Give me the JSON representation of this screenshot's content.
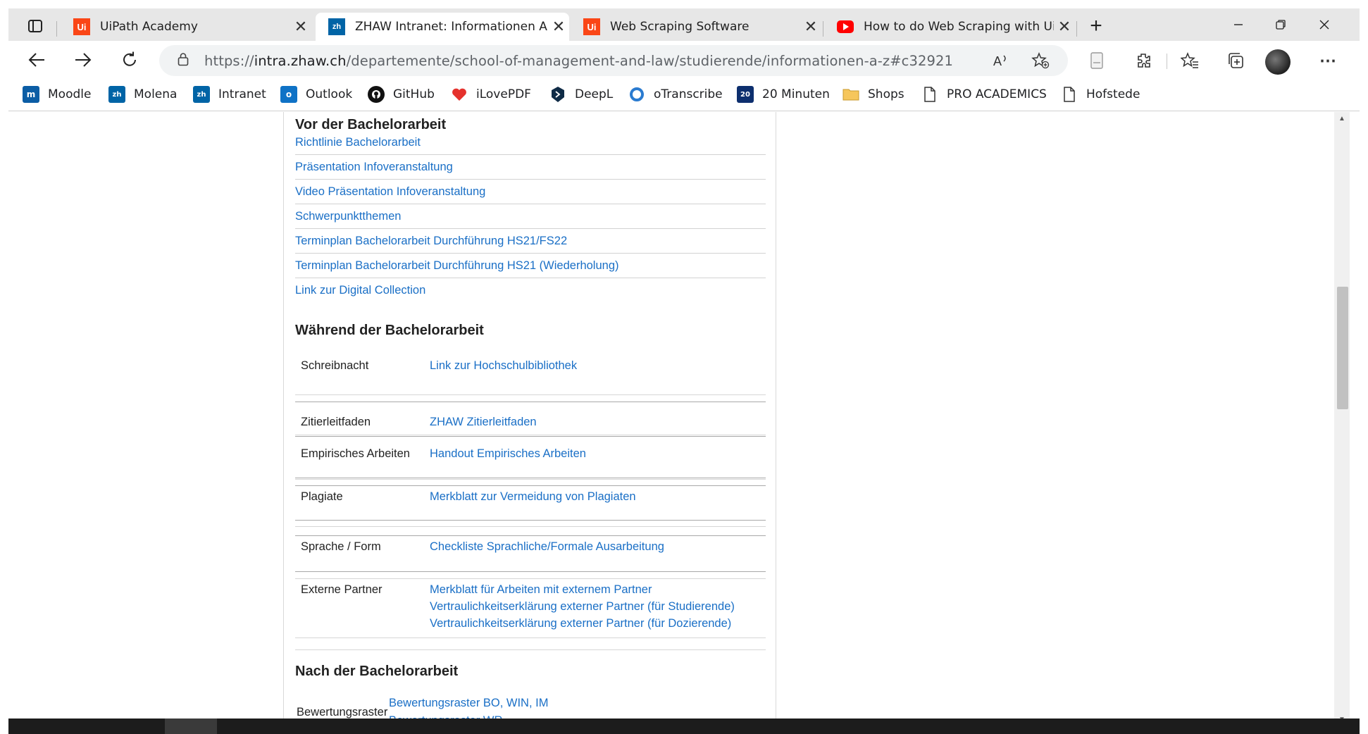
{
  "browser": {
    "tabs": [
      {
        "title": "UiPath Academy",
        "favicon": "uipath-icon",
        "active": false
      },
      {
        "title": "ZHAW Intranet: Informationen A",
        "favicon": "zhaw-icon",
        "active": true
      },
      {
        "title": "Web Scraping Software",
        "favicon": "uipath-icon",
        "active": false
      },
      {
        "title": "How to do Web Scraping with Ui",
        "favicon": "youtube-icon",
        "active": false
      }
    ],
    "address": {
      "scheme": "https://",
      "domain": "intra.zhaw.ch",
      "path": "/departemente/school-of-management-and-law/studierende/informationen-a-z#c32921"
    },
    "bookmarks": [
      {
        "label": "Moodle",
        "icon": "moodle-icon"
      },
      {
        "label": "Molena",
        "icon": "zhaw-icon"
      },
      {
        "label": "Intranet",
        "icon": "zhaw-icon"
      },
      {
        "label": "Outlook",
        "icon": "outlook-icon"
      },
      {
        "label": "GitHub",
        "icon": "github-icon"
      },
      {
        "label": "iLovePDF",
        "icon": "heart-icon"
      },
      {
        "label": "DeepL",
        "icon": "deepl-icon"
      },
      {
        "label": "oTranscribe",
        "icon": "otranscribe-icon"
      },
      {
        "label": "20 Minuten",
        "icon": "news-icon"
      },
      {
        "label": "Shops",
        "icon": "folder-icon"
      },
      {
        "label": "PRO ACADEMICS",
        "icon": "page-icon"
      },
      {
        "label": "Hofstede",
        "icon": "page-icon"
      }
    ],
    "colors": {
      "accent_link": "#1a6fc6",
      "tab_bar": "#e7e7e7"
    }
  },
  "page": {
    "before": {
      "heading": "Vor der Bachelorarbeit",
      "links": [
        "Richtlinie Bachelorarbeit",
        "Präsentation Infoveranstaltung",
        "Video Präsentation Infoveranstaltung",
        "Schwerpunktthemen",
        "Terminplan Bachelorarbeit Durchführung HS21/FS22",
        "Terminplan Bachelorarbeit Durchführung HS21 (Wiederholung)",
        "Link zur Digital Collection"
      ]
    },
    "during": {
      "heading": "Während der Bachelorarbeit",
      "rows": [
        {
          "label": "Schreibnacht",
          "links": [
            "Link zur Hochschulbibliothek"
          ]
        },
        {
          "label": "Zitierleitfaden",
          "links": [
            "ZHAW Zitierleitfaden"
          ]
        },
        {
          "label": "Empirisches Arbeiten",
          "links": [
            "Handout Empirisches Arbeiten"
          ]
        },
        {
          "label": "Plagiate",
          "links": [
            "Merkblatt zur Vermeidung von Plagiaten"
          ]
        },
        {
          "label": "Sprache / Form",
          "links": [
            "Checkliste Sprachliche/Formale Ausarbeitung"
          ]
        },
        {
          "label": "Externe Partner",
          "links": [
            "Merkblatt für Arbeiten mit externem Partner",
            "Vertraulichkeitserklärung externer Partner (für Studierende)",
            "Vertraulichkeitserklärung externer Partner (für Dozierende)"
          ]
        }
      ]
    },
    "after": {
      "heading": "Nach der Bachelorarbeit",
      "rows": [
        {
          "label": "Bewertungsraster",
          "links": [
            "Bewertungsraster BO, WIN, IM",
            "Bewertungsraster WR"
          ]
        }
      ]
    }
  }
}
